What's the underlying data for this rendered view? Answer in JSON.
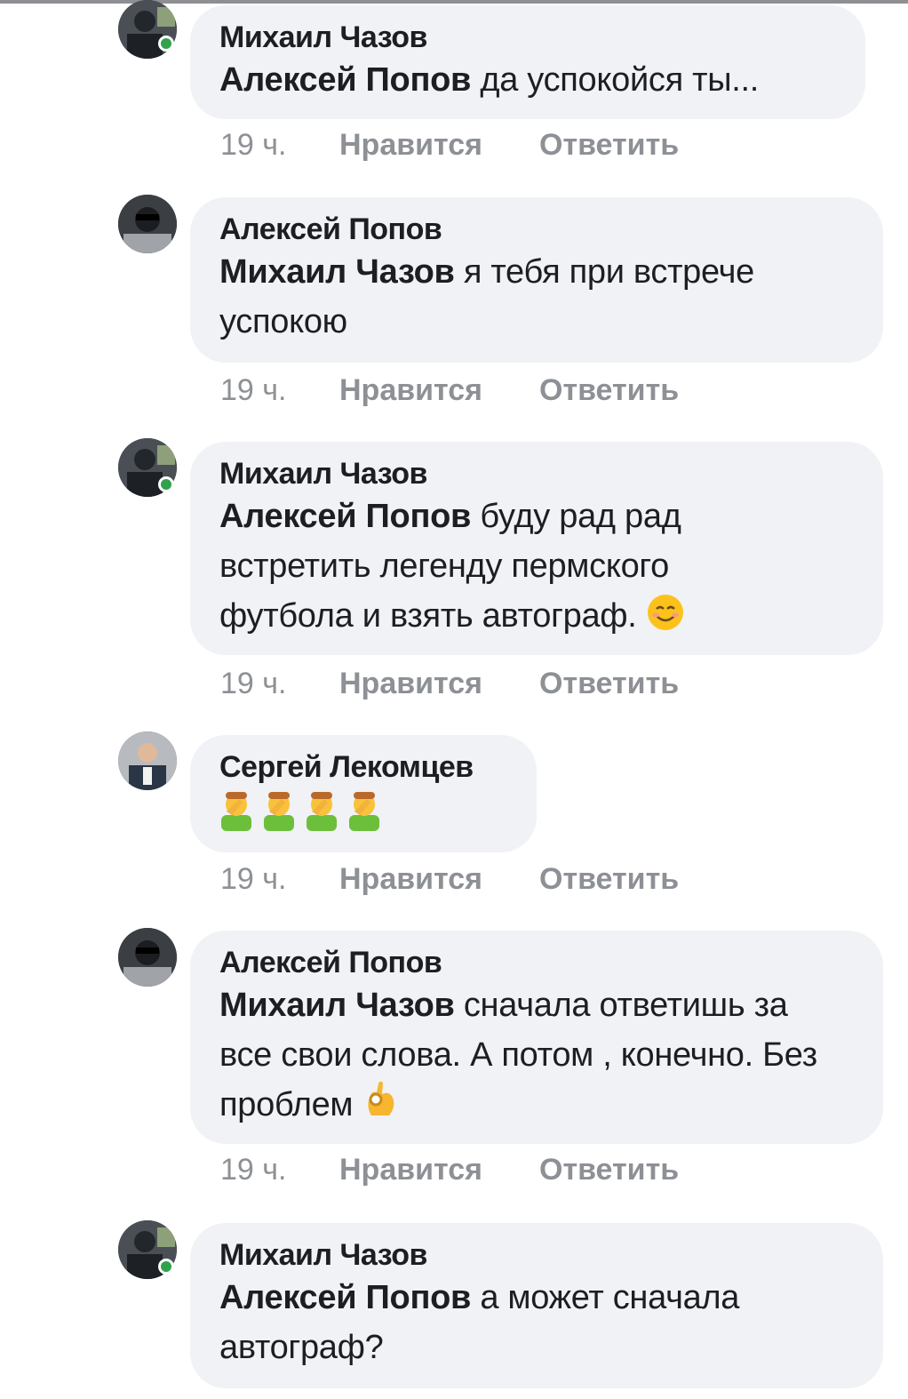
{
  "comments": [
    {
      "author": "Михаил Чазов",
      "mention": "Алексей Попов",
      "text": "да успокойся ты...",
      "time": "19 ч.",
      "like_label": "Нравится",
      "reply_label": "Ответить",
      "online": true
    },
    {
      "author": "Алексей Попов",
      "mention": "Михаил Чазов",
      "text": "я тебя при встрече успокою",
      "time": "19 ч.",
      "like_label": "Нравится",
      "reply_label": "Ответить",
      "online": false
    },
    {
      "author": "Михаил Чазов",
      "mention": "Алексей Попов",
      "text": "буду рад рад встретить легенду пермского футбола и взять автограф.",
      "emoji": "smiling-face-emoji",
      "time": "19 ч.",
      "like_label": "Нравится",
      "reply_label": "Ответить",
      "online": true
    },
    {
      "author": "Сергей Лекомцев",
      "mention": "",
      "text": "",
      "emoji": "man-facepalming-emoji ×4",
      "time": "19 ч.",
      "like_label": "Нравится",
      "reply_label": "Ответить",
      "online": false
    },
    {
      "author": "Алексей Попов",
      "mention": "Михаил Чазов",
      "text": "сначала ответишь за все свои слова. А потом , конечно. Без проблем",
      "emoji": "ok-hand-emoji",
      "time": "19 ч.",
      "like_label": "Нравится",
      "reply_label": "Ответить",
      "online": false
    },
    {
      "author": "Михаил Чазов",
      "mention": "Алексей Попов",
      "text": "а может сначала автограф?",
      "online": true
    }
  ],
  "colors": {
    "bubble": "#f0f2f5",
    "meta": "#8d9095",
    "online": "#31a24c"
  }
}
